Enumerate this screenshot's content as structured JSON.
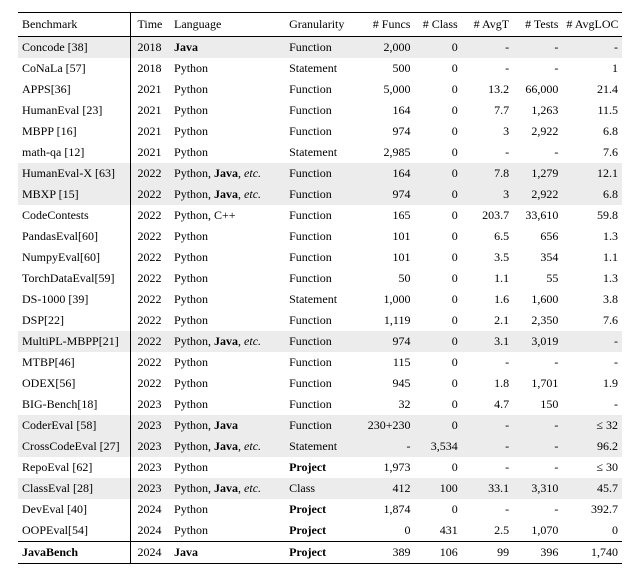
{
  "headers": {
    "benchmark": "Benchmark",
    "time": "Time",
    "language": "Language",
    "granularity": "Granularity",
    "funcs": "# Funcs",
    "class": "# Class",
    "avgt": "# AvgT",
    "tests": "# Tests",
    "avgloc": "# AvgLOC"
  },
  "rows": [
    {
      "shade": true,
      "group_end": false,
      "name": "Concode [38]",
      "name_bold": false,
      "time": "2018",
      "lang_pre": "",
      "lang_bold": "Java",
      "lang_post": "",
      "gran": "Function",
      "gran_bold": false,
      "funcs": "2,000",
      "class": "0",
      "avgt": "-",
      "tests": "-",
      "avgloc": "-"
    },
    {
      "shade": false,
      "group_end": false,
      "name": "CoNaLa [57]",
      "name_bold": false,
      "time": "2018",
      "lang_pre": "Python",
      "lang_bold": "",
      "lang_post": "",
      "gran": "Statement",
      "gran_bold": false,
      "funcs": "500",
      "class": "0",
      "avgt": "-",
      "tests": "-",
      "avgloc": "1"
    },
    {
      "shade": false,
      "group_end": false,
      "name": "APPS[36]",
      "name_bold": false,
      "time": "2021",
      "lang_pre": "Python",
      "lang_bold": "",
      "lang_post": "",
      "gran": "Function",
      "gran_bold": false,
      "funcs": "5,000",
      "class": "0",
      "avgt": "13.2",
      "tests": "66,000",
      "avgloc": "21.4"
    },
    {
      "shade": false,
      "group_end": false,
      "name": "HumanEval [23]",
      "name_bold": false,
      "time": "2021",
      "lang_pre": "Python",
      "lang_bold": "",
      "lang_post": "",
      "gran": "Function",
      "gran_bold": false,
      "funcs": "164",
      "class": "0",
      "avgt": "7.7",
      "tests": "1,263",
      "avgloc": "11.5"
    },
    {
      "shade": false,
      "group_end": false,
      "name": "MBPP [16]",
      "name_bold": false,
      "time": "2021",
      "lang_pre": "Python",
      "lang_bold": "",
      "lang_post": "",
      "gran": "Function",
      "gran_bold": false,
      "funcs": "974",
      "class": "0",
      "avgt": "3",
      "tests": "2,922",
      "avgloc": "6.8"
    },
    {
      "shade": false,
      "group_end": false,
      "name": "math-qa [12]",
      "name_bold": false,
      "time": "2021",
      "lang_pre": "Python",
      "lang_bold": "",
      "lang_post": "",
      "gran": "Statement",
      "gran_bold": false,
      "funcs": "2,985",
      "class": "0",
      "avgt": "-",
      "tests": "-",
      "avgloc": "7.6"
    },
    {
      "shade": true,
      "group_end": false,
      "name": "HumanEval-X [63]",
      "name_bold": false,
      "time": "2022",
      "lang_pre": "Python, ",
      "lang_bold": "Java",
      "lang_post": ", ",
      "gran": "Function",
      "gran_bold": false,
      "funcs": "164",
      "class": "0",
      "avgt": "7.8",
      "tests": "1,279",
      "avgloc": "12.1",
      "etc": true
    },
    {
      "shade": true,
      "group_end": false,
      "name": "MBXP [15]",
      "name_bold": false,
      "time": "2022",
      "lang_pre": "Python, ",
      "lang_bold": "Java",
      "lang_post": ", ",
      "gran": "Function",
      "gran_bold": false,
      "funcs": "974",
      "class": "0",
      "avgt": "3",
      "tests": "2,922",
      "avgloc": "6.8",
      "etc": true
    },
    {
      "shade": false,
      "group_end": false,
      "name": "CodeContests",
      "name_bold": false,
      "time": "2022",
      "lang_pre": "Python, C++",
      "lang_bold": "",
      "lang_post": "",
      "gran": "Function",
      "gran_bold": false,
      "funcs": "165",
      "class": "0",
      "avgt": "203.7",
      "tests": "33,610",
      "avgloc": "59.8"
    },
    {
      "shade": false,
      "group_end": false,
      "name": "PandasEval[60]",
      "name_bold": false,
      "time": "2022",
      "lang_pre": "Python",
      "lang_bold": "",
      "lang_post": "",
      "gran": "Function",
      "gran_bold": false,
      "funcs": "101",
      "class": "0",
      "avgt": "6.5",
      "tests": "656",
      "avgloc": "1.3"
    },
    {
      "shade": false,
      "group_end": false,
      "name": "NumpyEval[60]",
      "name_bold": false,
      "time": "2022",
      "lang_pre": "Python",
      "lang_bold": "",
      "lang_post": "",
      "gran": "Function",
      "gran_bold": false,
      "funcs": "101",
      "class": "0",
      "avgt": "3.5",
      "tests": "354",
      "avgloc": "1.1"
    },
    {
      "shade": false,
      "group_end": false,
      "name": "TorchDataEval[59]",
      "name_bold": false,
      "time": "2022",
      "lang_pre": "Python",
      "lang_bold": "",
      "lang_post": "",
      "gran": "Function",
      "gran_bold": false,
      "funcs": "50",
      "class": "0",
      "avgt": "1.1",
      "tests": "55",
      "avgloc": "1.3"
    },
    {
      "shade": false,
      "group_end": false,
      "name": "DS-1000 [39]",
      "name_bold": false,
      "time": "2022",
      "lang_pre": "Python",
      "lang_bold": "",
      "lang_post": "",
      "gran": "Statement",
      "gran_bold": false,
      "funcs": "1,000",
      "class": "0",
      "avgt": "1.6",
      "tests": "1,600",
      "avgloc": "3.8"
    },
    {
      "shade": false,
      "group_end": false,
      "name": "DSP[22]",
      "name_bold": false,
      "time": "2022",
      "lang_pre": "Python",
      "lang_bold": "",
      "lang_post": "",
      "gran": "Function",
      "gran_bold": false,
      "funcs": "1,119",
      "class": "0",
      "avgt": "2.1",
      "tests": "2,350",
      "avgloc": "7.6"
    },
    {
      "shade": true,
      "group_end": false,
      "name": "MultiPL-MBPP[21]",
      "name_bold": false,
      "time": "2022",
      "lang_pre": "Python, ",
      "lang_bold": "Java",
      "lang_post": ", ",
      "gran": "Function",
      "gran_bold": false,
      "funcs": "974",
      "class": "0",
      "avgt": "3.1",
      "tests": "3,019",
      "avgloc": "-",
      "etc": true
    },
    {
      "shade": false,
      "group_end": false,
      "name": "MTBP[46]",
      "name_bold": false,
      "time": "2022",
      "lang_pre": "Python",
      "lang_bold": "",
      "lang_post": "",
      "gran": "Function",
      "gran_bold": false,
      "funcs": "115",
      "class": "0",
      "avgt": "-",
      "tests": "-",
      "avgloc": "-"
    },
    {
      "shade": false,
      "group_end": false,
      "name": "ODEX[56]",
      "name_bold": false,
      "time": "2022",
      "lang_pre": "Python",
      "lang_bold": "",
      "lang_post": "",
      "gran": "Function",
      "gran_bold": false,
      "funcs": "945",
      "class": "0",
      "avgt": "1.8",
      "tests": "1,701",
      "avgloc": "1.9"
    },
    {
      "shade": false,
      "group_end": false,
      "name": "BIG-Bench[18]",
      "name_bold": false,
      "time": "2023",
      "lang_pre": "Python",
      "lang_bold": "",
      "lang_post": "",
      "gran": "Function",
      "gran_bold": false,
      "funcs": "32",
      "class": "0",
      "avgt": "4.7",
      "tests": "150",
      "avgloc": "-"
    },
    {
      "shade": true,
      "group_end": false,
      "name": "CoderEval [58]",
      "name_bold": false,
      "time": "2023",
      "lang_pre": "Python, ",
      "lang_bold": "Java",
      "lang_post": "",
      "gran": "Function",
      "gran_bold": false,
      "funcs": "230+230",
      "class": "0",
      "avgt": "-",
      "tests": "-",
      "avgloc": "≤ 32"
    },
    {
      "shade": true,
      "group_end": false,
      "name": "CrossCodeEval [27]",
      "name_bold": false,
      "time": "2023",
      "lang_pre": "Python, ",
      "lang_bold": "Java",
      "lang_post": ", ",
      "gran": "Statement",
      "gran_bold": false,
      "funcs": "-",
      "class": "3,534",
      "avgt": "-",
      "tests": "-",
      "avgloc": "96.2",
      "etc": true
    },
    {
      "shade": false,
      "group_end": false,
      "name": "RepoEval [62]",
      "name_bold": false,
      "time": "2023",
      "lang_pre": "Python",
      "lang_bold": "",
      "lang_post": "",
      "gran": "Project",
      "gran_bold": true,
      "funcs": "1,973",
      "class": "0",
      "avgt": "-",
      "tests": "-",
      "avgloc": "≤ 30"
    },
    {
      "shade": true,
      "group_end": false,
      "name": "ClassEval [28]",
      "name_bold": false,
      "time": "2023",
      "lang_pre": "Python, ",
      "lang_bold": "Java",
      "lang_post": ", ",
      "gran": "Class",
      "gran_bold": false,
      "funcs": "412",
      "class": "100",
      "avgt": "33.1",
      "tests": "3,310",
      "avgloc": "45.7",
      "etc": true
    },
    {
      "shade": false,
      "group_end": false,
      "name": "DevEval [40]",
      "name_bold": false,
      "time": "2024",
      "lang_pre": "Python",
      "lang_bold": "",
      "lang_post": "",
      "gran": "Project",
      "gran_bold": true,
      "funcs": "1,874",
      "class": "0",
      "avgt": "-",
      "tests": "-",
      "avgloc": "392.7"
    },
    {
      "shade": false,
      "group_end": true,
      "name": "OOPEval[54]",
      "name_bold": false,
      "time": "2024",
      "lang_pre": "Python",
      "lang_bold": "",
      "lang_post": "",
      "gran": "Project",
      "gran_bold": true,
      "funcs": "0",
      "class": "431",
      "avgt": "2.5",
      "tests": "1,070",
      "avgloc": "0"
    },
    {
      "shade": false,
      "group_end": false,
      "final": true,
      "name": "JavaBench",
      "name_bold": true,
      "time": "2024",
      "lang_pre": "",
      "lang_bold": "Java",
      "lang_post": "",
      "gran": "Project",
      "gran_bold": true,
      "funcs": "389",
      "class": "106",
      "avgt": "99",
      "tests": "396",
      "avgloc": "1,740"
    }
  ],
  "etc_label": "etc."
}
